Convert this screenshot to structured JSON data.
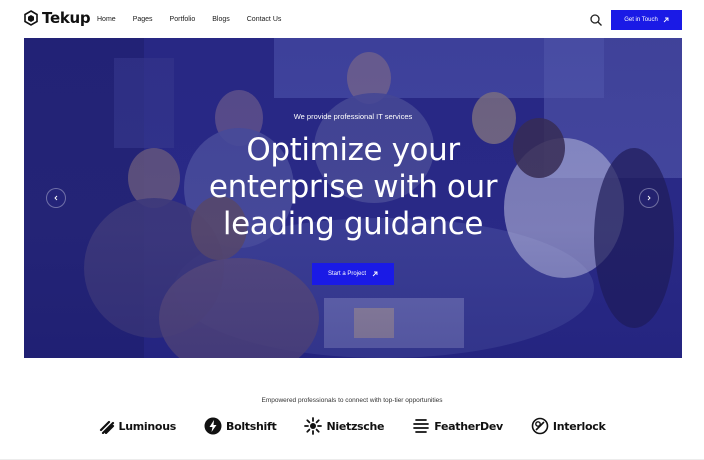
{
  "brand": {
    "name": "Tekup",
    "logo_icon": "hexagon-logo-icon"
  },
  "nav": {
    "items": [
      {
        "label": "Home"
      },
      {
        "label": "Pages"
      },
      {
        "label": "Portfolio"
      },
      {
        "label": "Blogs"
      },
      {
        "label": "Contact Us"
      }
    ]
  },
  "header": {
    "search_icon": "search-icon",
    "cta_label": "Get in Touch",
    "cta_icon": "arrow-up-right-icon",
    "accent_color": "#1a1ae6"
  },
  "hero": {
    "eyebrow": "We provide professional IT services",
    "title_lines": [
      "Optimize your",
      "enterprise with our",
      "leading guidance"
    ],
    "button_label": "Start a Project",
    "button_icon": "arrow-up-right-icon",
    "prev_icon": "chevron-left-icon",
    "next_icon": "chevron-right-icon"
  },
  "partners": {
    "tagline": "Empowered professionals to connect with top-tier opportunities",
    "logos": [
      {
        "name": "Luminous",
        "icon": "luminous-logo-icon"
      },
      {
        "name": "Boltshift",
        "icon": "boltshift-logo-icon"
      },
      {
        "name": "Nietzsche",
        "icon": "nietzsche-logo-icon"
      },
      {
        "name": "FeatherDev",
        "icon": "featherdev-logo-icon"
      },
      {
        "name": "Interlock",
        "icon": "interlock-logo-icon"
      }
    ]
  }
}
